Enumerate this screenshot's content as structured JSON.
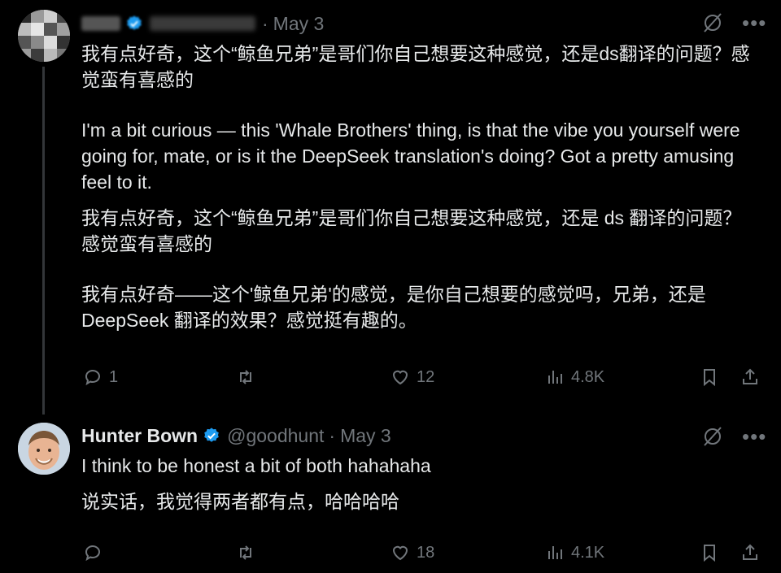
{
  "tweet1": {
    "date": "May 3",
    "separator": "·",
    "paragraphs": [
      "我有点好奇，这个“鲸鱼兄弟”是哥们你自己想要这种感觉，还是ds翻译的问题？感觉蛮有喜感的",
      "I'm a bit curious — this 'Whale Brothers' thing, is that the vibe you yourself were going for, mate, or is it the DeepSeek translation's doing? Got a pretty amusing feel to it.",
      "我有点好奇，这个“鲸鱼兄弟”是哥们你自己想要这种感觉，还是 ds 翻译的问题？感觉蛮有喜感的",
      "我有点好奇——这个'鲸鱼兄弟'的感觉，是你自己想要的感觉吗，兄弟，还是 DeepSeek 翻译的效果？感觉挺有趣的。"
    ],
    "replies": "1",
    "retweets": "",
    "likes": "12",
    "views": "4.8K"
  },
  "tweet2": {
    "name": "Hunter Bown",
    "handle": "@goodhunt",
    "separator": "·",
    "date": "May 3",
    "paragraphs": [
      "I think to be honest a bit of both hahahaha",
      "说实话，我觉得两者都有点，哈哈哈哈"
    ],
    "replies": "",
    "retweets": "",
    "likes": "18",
    "views": "4.1K"
  },
  "colors": {
    "background": "#000000",
    "text": "#e7e9ea",
    "muted": "#71767b",
    "verified": "#1d9bf0"
  }
}
